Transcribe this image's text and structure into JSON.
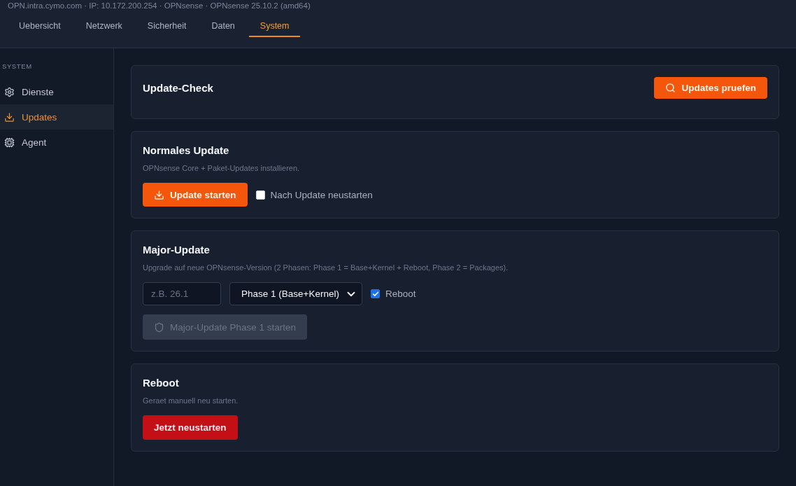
{
  "header": {
    "host_info": "OPN.intra.cymo.com · IP: 10.172.200.254 · OPNsense · OPNsense 25.10.2 (amd64)",
    "tabs": [
      {
        "label": "Uebersicht",
        "selected": false
      },
      {
        "label": "Netzwerk",
        "selected": false
      },
      {
        "label": "Sicherheit",
        "selected": false
      },
      {
        "label": "Daten",
        "selected": false
      },
      {
        "label": "System",
        "selected": true
      }
    ]
  },
  "sidebar": {
    "section": "SYSTEM",
    "items": [
      {
        "label": "Dienste",
        "selected": false
      },
      {
        "label": "Updates",
        "selected": true
      },
      {
        "label": "Agent",
        "selected": false
      }
    ]
  },
  "cards": [
    {
      "kind": "check",
      "title": "Update-Check",
      "button": {
        "label": "Updates pruefen",
        "disabled": false
      }
    },
    {
      "kind": "normal",
      "title": "Normales Update",
      "description": "OPNsense Core + Paket-Updates installieren.",
      "button": {
        "label": "Update starten",
        "disabled": false
      },
      "checkbox": {
        "label": "Nach Update neustarten",
        "checked": false
      }
    },
    {
      "kind": "major",
      "title": "Major-Update",
      "description": "Upgrade auf neue OPNsense-Version (2 Phasen: Phase 1 = Base+Kernel + Reboot, Phase 2 = Packages).",
      "version_field": {
        "placeholder": "z.B. 26.1"
      },
      "phase_select": {
        "value": "Phase 1 (Base+Kernel)"
      },
      "checkbox": {
        "label": "Reboot",
        "checked": true
      },
      "button": {
        "label": "Major-Update Phase 1 starten",
        "disabled": true
      }
    },
    {
      "kind": "reboot",
      "title": "Reboot",
      "description": "Geraet manuell neu starten.",
      "button": {
        "label": "Jetzt neustarten",
        "disabled": false
      }
    }
  ]
}
